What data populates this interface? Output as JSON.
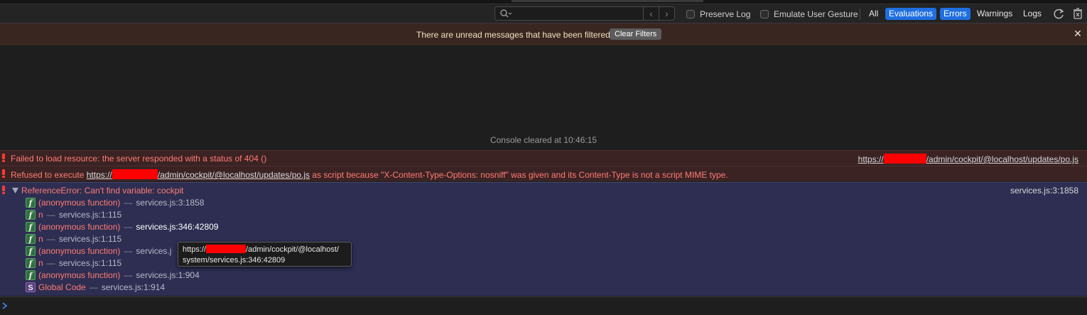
{
  "toolbar": {
    "search_placeholder": "",
    "preserve_log_label": "Preserve Log",
    "emulate_gesture_label": "Emulate User Gesture",
    "filters": [
      {
        "label": "All",
        "active": false
      },
      {
        "label": "Evaluations",
        "active": true
      },
      {
        "label": "Errors",
        "active": true
      },
      {
        "label": "Warnings",
        "active": false
      },
      {
        "label": "Logs",
        "active": false
      }
    ],
    "icons": [
      "search-icon",
      "chevron-left-icon",
      "chevron-right-icon",
      "reload-icon",
      "trash-icon"
    ]
  },
  "banner": {
    "message": "There are unread messages that have been filtered",
    "button_label": "Clear Filters",
    "close_glyph": "✕"
  },
  "console": {
    "cleared_text": "Console cleared at 10:46:15",
    "errors": [
      {
        "text": "Failed to load resource: the server responded with a status of 404 ()",
        "source_prefix": "https://",
        "source_suffix": "/admin/cockpit/@localhost/updates/po.js"
      },
      {
        "text_prefix": "Refused to execute ",
        "link_prefix": "https://",
        "link_suffix": "/admin/cockpit/@localhost/updates/po.js",
        "text_suffix": " as script because \"X-Content-Type-Options: nosniff\" was given and its Content-Type is not a script MIME type."
      }
    ],
    "reference_error": {
      "message": "ReferenceError: Can't find variable: cockpit",
      "source": "services.js:3:1858",
      "frames": [
        {
          "badge": "f",
          "name": "(anonymous function)",
          "location": "services.js:3:1858"
        },
        {
          "badge": "f",
          "name": "n",
          "location": "services.js:1:115"
        },
        {
          "badge": "f",
          "name": "(anonymous function)",
          "location": "services.js:346:42809"
        },
        {
          "badge": "f",
          "name": "n",
          "location": "services.js:1:115"
        },
        {
          "badge": "f",
          "name": "(anonymous function)",
          "location": "services.j"
        },
        {
          "badge": "f",
          "name": "n",
          "location": "services.js:1:115"
        },
        {
          "badge": "f",
          "name": "(anonymous function)",
          "location": "services.js:1:904"
        },
        {
          "badge": "S",
          "name": "Global Code",
          "location": "services.js:1:914"
        }
      ],
      "separator": "—"
    },
    "tooltip": {
      "line1_prefix": "https://",
      "line1_suffix": "/admin/cockpit/@localhost/",
      "line2": "system/services.js:346:42809"
    }
  },
  "colors": {
    "background": "#1e1e1e",
    "error_row": "#3b2324",
    "error_text": "#ff7b73",
    "selected_block": "#2d2e52",
    "filter_active": "#1f6fe0",
    "redaction": "#ff0000"
  }
}
